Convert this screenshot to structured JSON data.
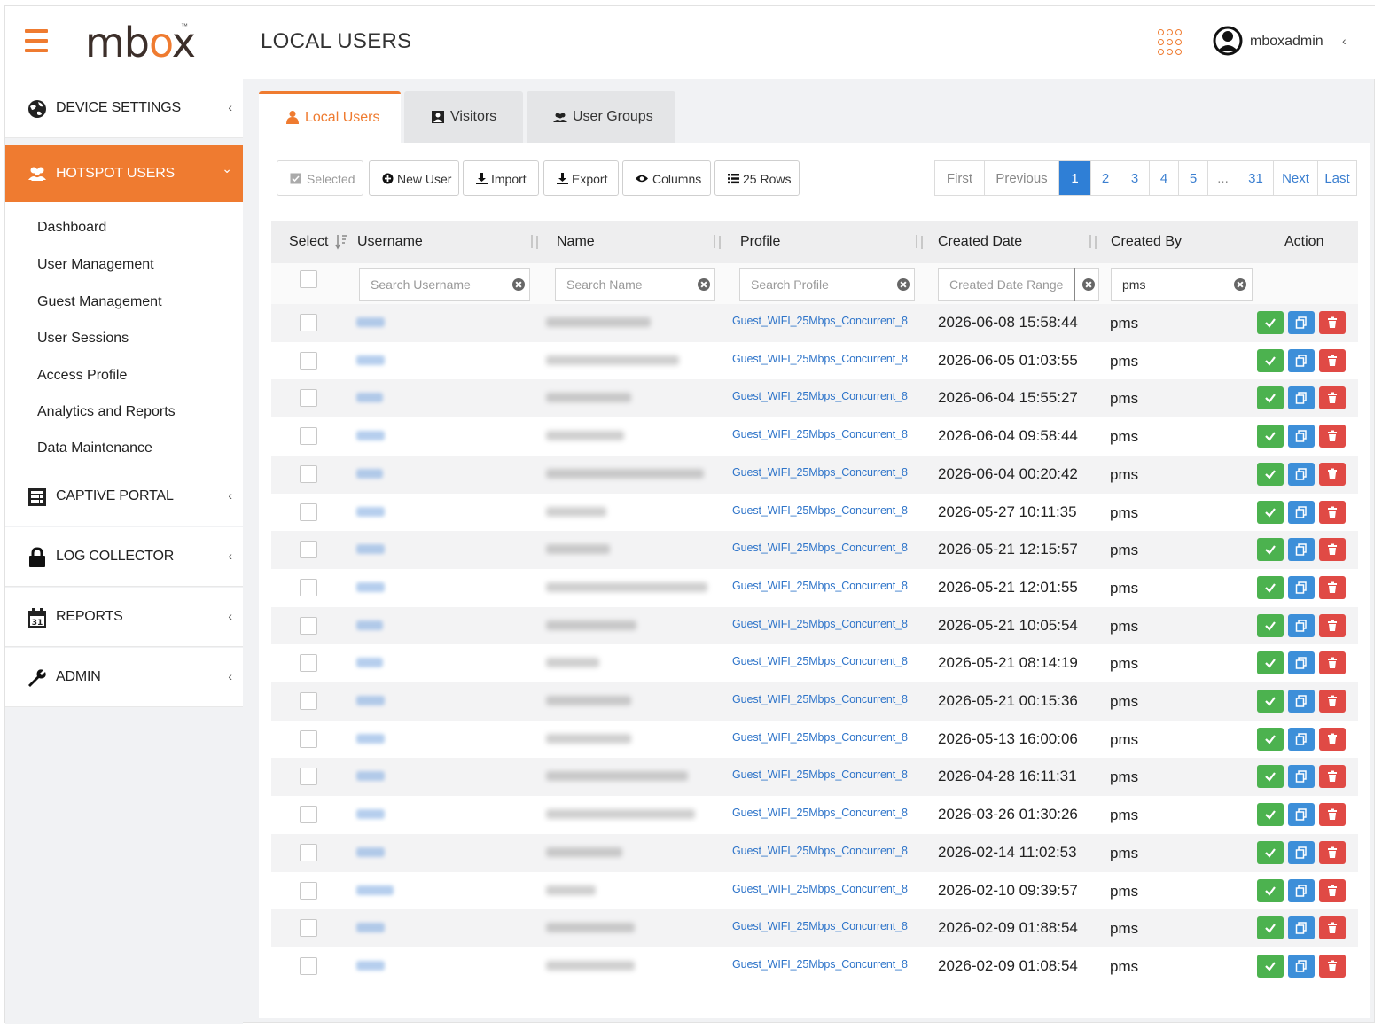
{
  "app": {
    "logo_text_m": "mb",
    "logo_text_o": "o",
    "logo_text_x": "x",
    "logo_tm": "™",
    "page_title": "LOCAL USERS",
    "username": "mboxadmin",
    "user_caret": "‹"
  },
  "colors": {
    "accent": "#ef7b30",
    "link": "#2e74c9",
    "primary": "#2f7fd6",
    "success": "#4cb24f",
    "danger": "#e04a45"
  },
  "sidebar": {
    "device_settings": {
      "label": "DEVICE SETTINGS",
      "icon": "globe-gear-icon",
      "caret": "‹"
    },
    "hotspot_users": {
      "label": "HOTSPOT USERS",
      "icon": "users-icon",
      "caret": "⌄"
    },
    "submenu": [
      "Dashboard",
      "User Management",
      "Guest Management",
      "User Sessions",
      "Access Profile",
      "Analytics and Reports",
      "Data Maintenance"
    ],
    "captive_portal": {
      "label": "CAPTIVE PORTAL",
      "icon": "portal-icon",
      "caret": "‹"
    },
    "log_collector": {
      "label": "LOG COLLECTOR",
      "icon": "lock-icon",
      "caret": "‹"
    },
    "reports": {
      "label": "REPORTS",
      "icon": "calendar-icon",
      "caret": "‹"
    },
    "admin": {
      "label": "ADMIN",
      "icon": "wrench-icon",
      "caret": "‹"
    }
  },
  "tabs": {
    "local_users": "Local Users",
    "visitors": "Visitors",
    "user_groups": "User Groups"
  },
  "toolbar": {
    "selected": "Selected",
    "new_user": "New User",
    "import": "Import",
    "export": "Export",
    "columns": "Columns",
    "rows": "25 Rows"
  },
  "pager": {
    "first": "First",
    "previous": "Previous",
    "pages": [
      "1",
      "2",
      "3",
      "4",
      "5",
      "...",
      "31"
    ],
    "next": "Next",
    "last": "Last",
    "current": "1"
  },
  "table": {
    "headers": {
      "select": "Select",
      "username": "Username",
      "name": "Name",
      "profile": "Profile",
      "created_date": "Created Date",
      "created_by": "Created By",
      "action": "Action"
    },
    "filters": {
      "username_placeholder": "Search Username",
      "name_placeholder": "Search Name",
      "profile_placeholder": "Search Profile",
      "date_placeholder": "Created Date Range",
      "created_by_value": "pms"
    },
    "rows": [
      {
        "profile": "Guest_WIFI_25Mbps_Concurrent_8",
        "created_date": "2026-06-08 15:58:44",
        "created_by": "pms"
      },
      {
        "profile": "Guest_WIFI_25Mbps_Concurrent_8",
        "created_date": "2026-06-05 01:03:55",
        "created_by": "pms"
      },
      {
        "profile": "Guest_WIFI_25Mbps_Concurrent_8",
        "created_date": "2026-06-04 15:55:27",
        "created_by": "pms"
      },
      {
        "profile": "Guest_WIFI_25Mbps_Concurrent_8",
        "created_date": "2026-06-04 09:58:44",
        "created_by": "pms"
      },
      {
        "profile": "Guest_WIFI_25Mbps_Concurrent_8",
        "created_date": "2026-06-04 00:20:42",
        "created_by": "pms"
      },
      {
        "profile": "Guest_WIFI_25Mbps_Concurrent_8",
        "created_date": "2026-05-27 10:11:35",
        "created_by": "pms"
      },
      {
        "profile": "Guest_WIFI_25Mbps_Concurrent_8",
        "created_date": "2026-05-21 12:15:57",
        "created_by": "pms"
      },
      {
        "profile": "Guest_WIFI_25Mbps_Concurrent_8",
        "created_date": "2026-05-21 12:01:55",
        "created_by": "pms"
      },
      {
        "profile": "Guest_WIFI_25Mbps_Concurrent_8",
        "created_date": "2026-05-21 10:05:54",
        "created_by": "pms"
      },
      {
        "profile": "Guest_WIFI_25Mbps_Concurrent_8",
        "created_date": "2026-05-21 08:14:19",
        "created_by": "pms"
      },
      {
        "profile": "Guest_WIFI_25Mbps_Concurrent_8",
        "created_date": "2026-05-21 00:15:36",
        "created_by": "pms"
      },
      {
        "profile": "Guest_WIFI_25Mbps_Concurrent_8",
        "created_date": "2026-05-13 16:00:06",
        "created_by": "pms"
      },
      {
        "profile": "Guest_WIFI_25Mbps_Concurrent_8",
        "created_date": "2026-04-28 16:11:31",
        "created_by": "pms"
      },
      {
        "profile": "Guest_WIFI_25Mbps_Concurrent_8",
        "created_date": "2026-03-26 01:30:26",
        "created_by": "pms"
      },
      {
        "profile": "Guest_WIFI_25Mbps_Concurrent_8",
        "created_date": "2026-02-14 11:02:53",
        "created_by": "pms"
      },
      {
        "profile": "Guest_WIFI_25Mbps_Concurrent_8",
        "created_date": "2026-02-10 09:39:57",
        "created_by": "pms"
      },
      {
        "profile": "Guest_WIFI_25Mbps_Concurrent_8",
        "created_date": "2026-02-09 01:88:54",
        "created_by": "pms"
      },
      {
        "profile": "Guest_WIFI_25Mbps_Concurrent_8",
        "created_date": "2026-02-09 01:08:54",
        "created_by": "pms"
      }
    ]
  }
}
